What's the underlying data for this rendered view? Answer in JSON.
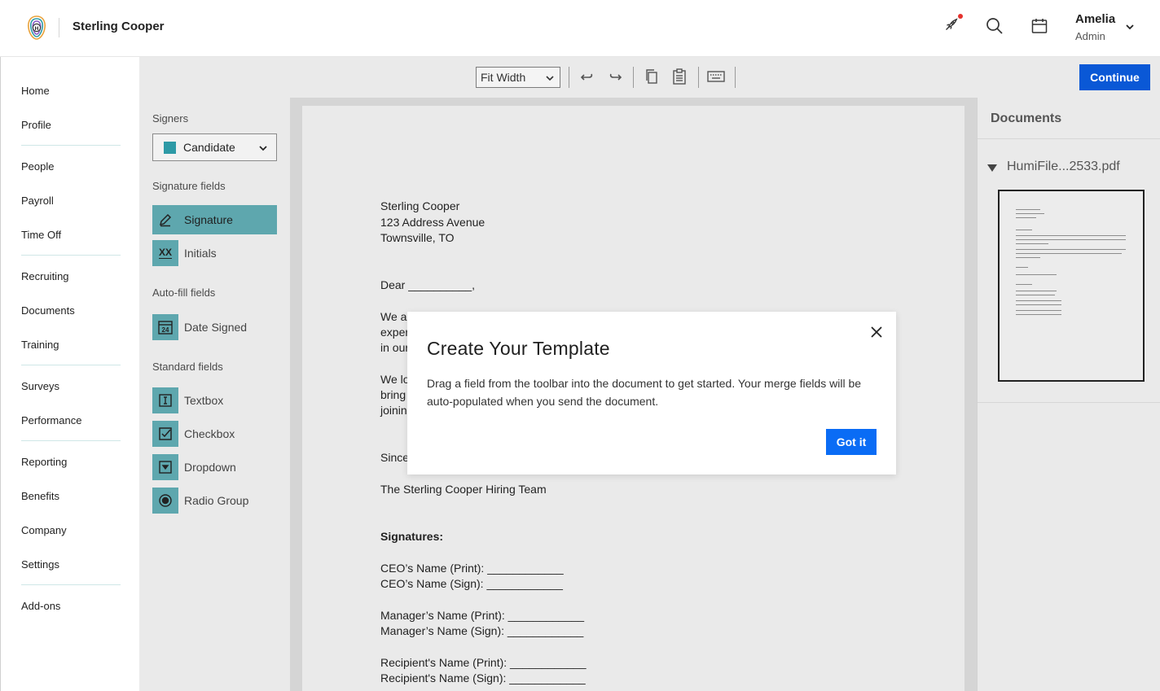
{
  "app": {
    "company_name": "Sterling Cooper",
    "user_name": "Amelia",
    "user_role": "Admin",
    "brand_color": "#2e9aa6",
    "accent_color": "#0a58d6"
  },
  "header_icons": [
    "rocket-icon",
    "search-icon",
    "calendar-icon",
    "chevron-down-icon"
  ],
  "sidebar": {
    "items": [
      {
        "label": "Home"
      },
      {
        "label": "Profile"
      },
      {
        "label": "People"
      },
      {
        "label": "Payroll"
      },
      {
        "label": "Time Off"
      },
      {
        "label": "Recruiting"
      },
      {
        "label": "Documents"
      },
      {
        "label": "Training"
      },
      {
        "label": "Surveys"
      },
      {
        "label": "Performance"
      },
      {
        "label": "Reporting"
      },
      {
        "label": "Benefits"
      },
      {
        "label": "Company"
      },
      {
        "label": "Settings"
      },
      {
        "label": "Add-ons"
      }
    ]
  },
  "toolbar": {
    "zoom_value": "Fit Width",
    "icons": [
      "undo-icon",
      "redo-icon",
      "copy-icon",
      "paste-icon",
      "keyboard-icon"
    ],
    "continue_label": "Continue"
  },
  "fields_panel": {
    "signers_label": "Signers",
    "signer_selected": "Candidate",
    "signature_fields_label": "Signature fields",
    "signature_fields": [
      {
        "label": "Signature",
        "icon": "pen-icon",
        "active": true
      },
      {
        "label": "Initials",
        "icon": "initials-icon",
        "active": false
      }
    ],
    "autofill_label": "Auto-fill fields",
    "autofill_fields": [
      {
        "label": "Date Signed",
        "icon": "date-icon",
        "badge": "24"
      }
    ],
    "standard_label": "Standard fields",
    "standard_fields": [
      {
        "label": "Textbox",
        "icon": "textbox-icon"
      },
      {
        "label": "Checkbox",
        "icon": "checkbox-icon"
      },
      {
        "label": "Dropdown",
        "icon": "dropdown-icon"
      },
      {
        "label": "Radio Group",
        "icon": "radio-icon"
      }
    ],
    "initials_glyph": "XX"
  },
  "document": {
    "lines": [
      "Sterling Cooper",
      "123 Address Avenue",
      "Townsville, TO",
      "Dear __________,",
      "We a",
      "exper",
      "in our",
      "We lo",
      "bring",
      "joinin",
      "Since",
      "The Sterling Cooper Hiring Team",
      "Signatures:",
      "CEO’s Name (Print): ____________",
      "CEO’s Name (Sign): ____________",
      "Manager’s Name (Print): ____________",
      "Manager’s Name (Sign): ____________",
      "Recipient's Name (Print): ____________",
      "Recipient's Name (Sign): ____________"
    ]
  },
  "documents_panel": {
    "title": "Documents",
    "file_name": "HumiFile...2533.pdf"
  },
  "modal": {
    "title": "Create Your Template",
    "body": "Drag a field from the toolbar into the document to get started. Your merge fields will be auto-populated when you send the document.",
    "button_label": "Got it"
  }
}
